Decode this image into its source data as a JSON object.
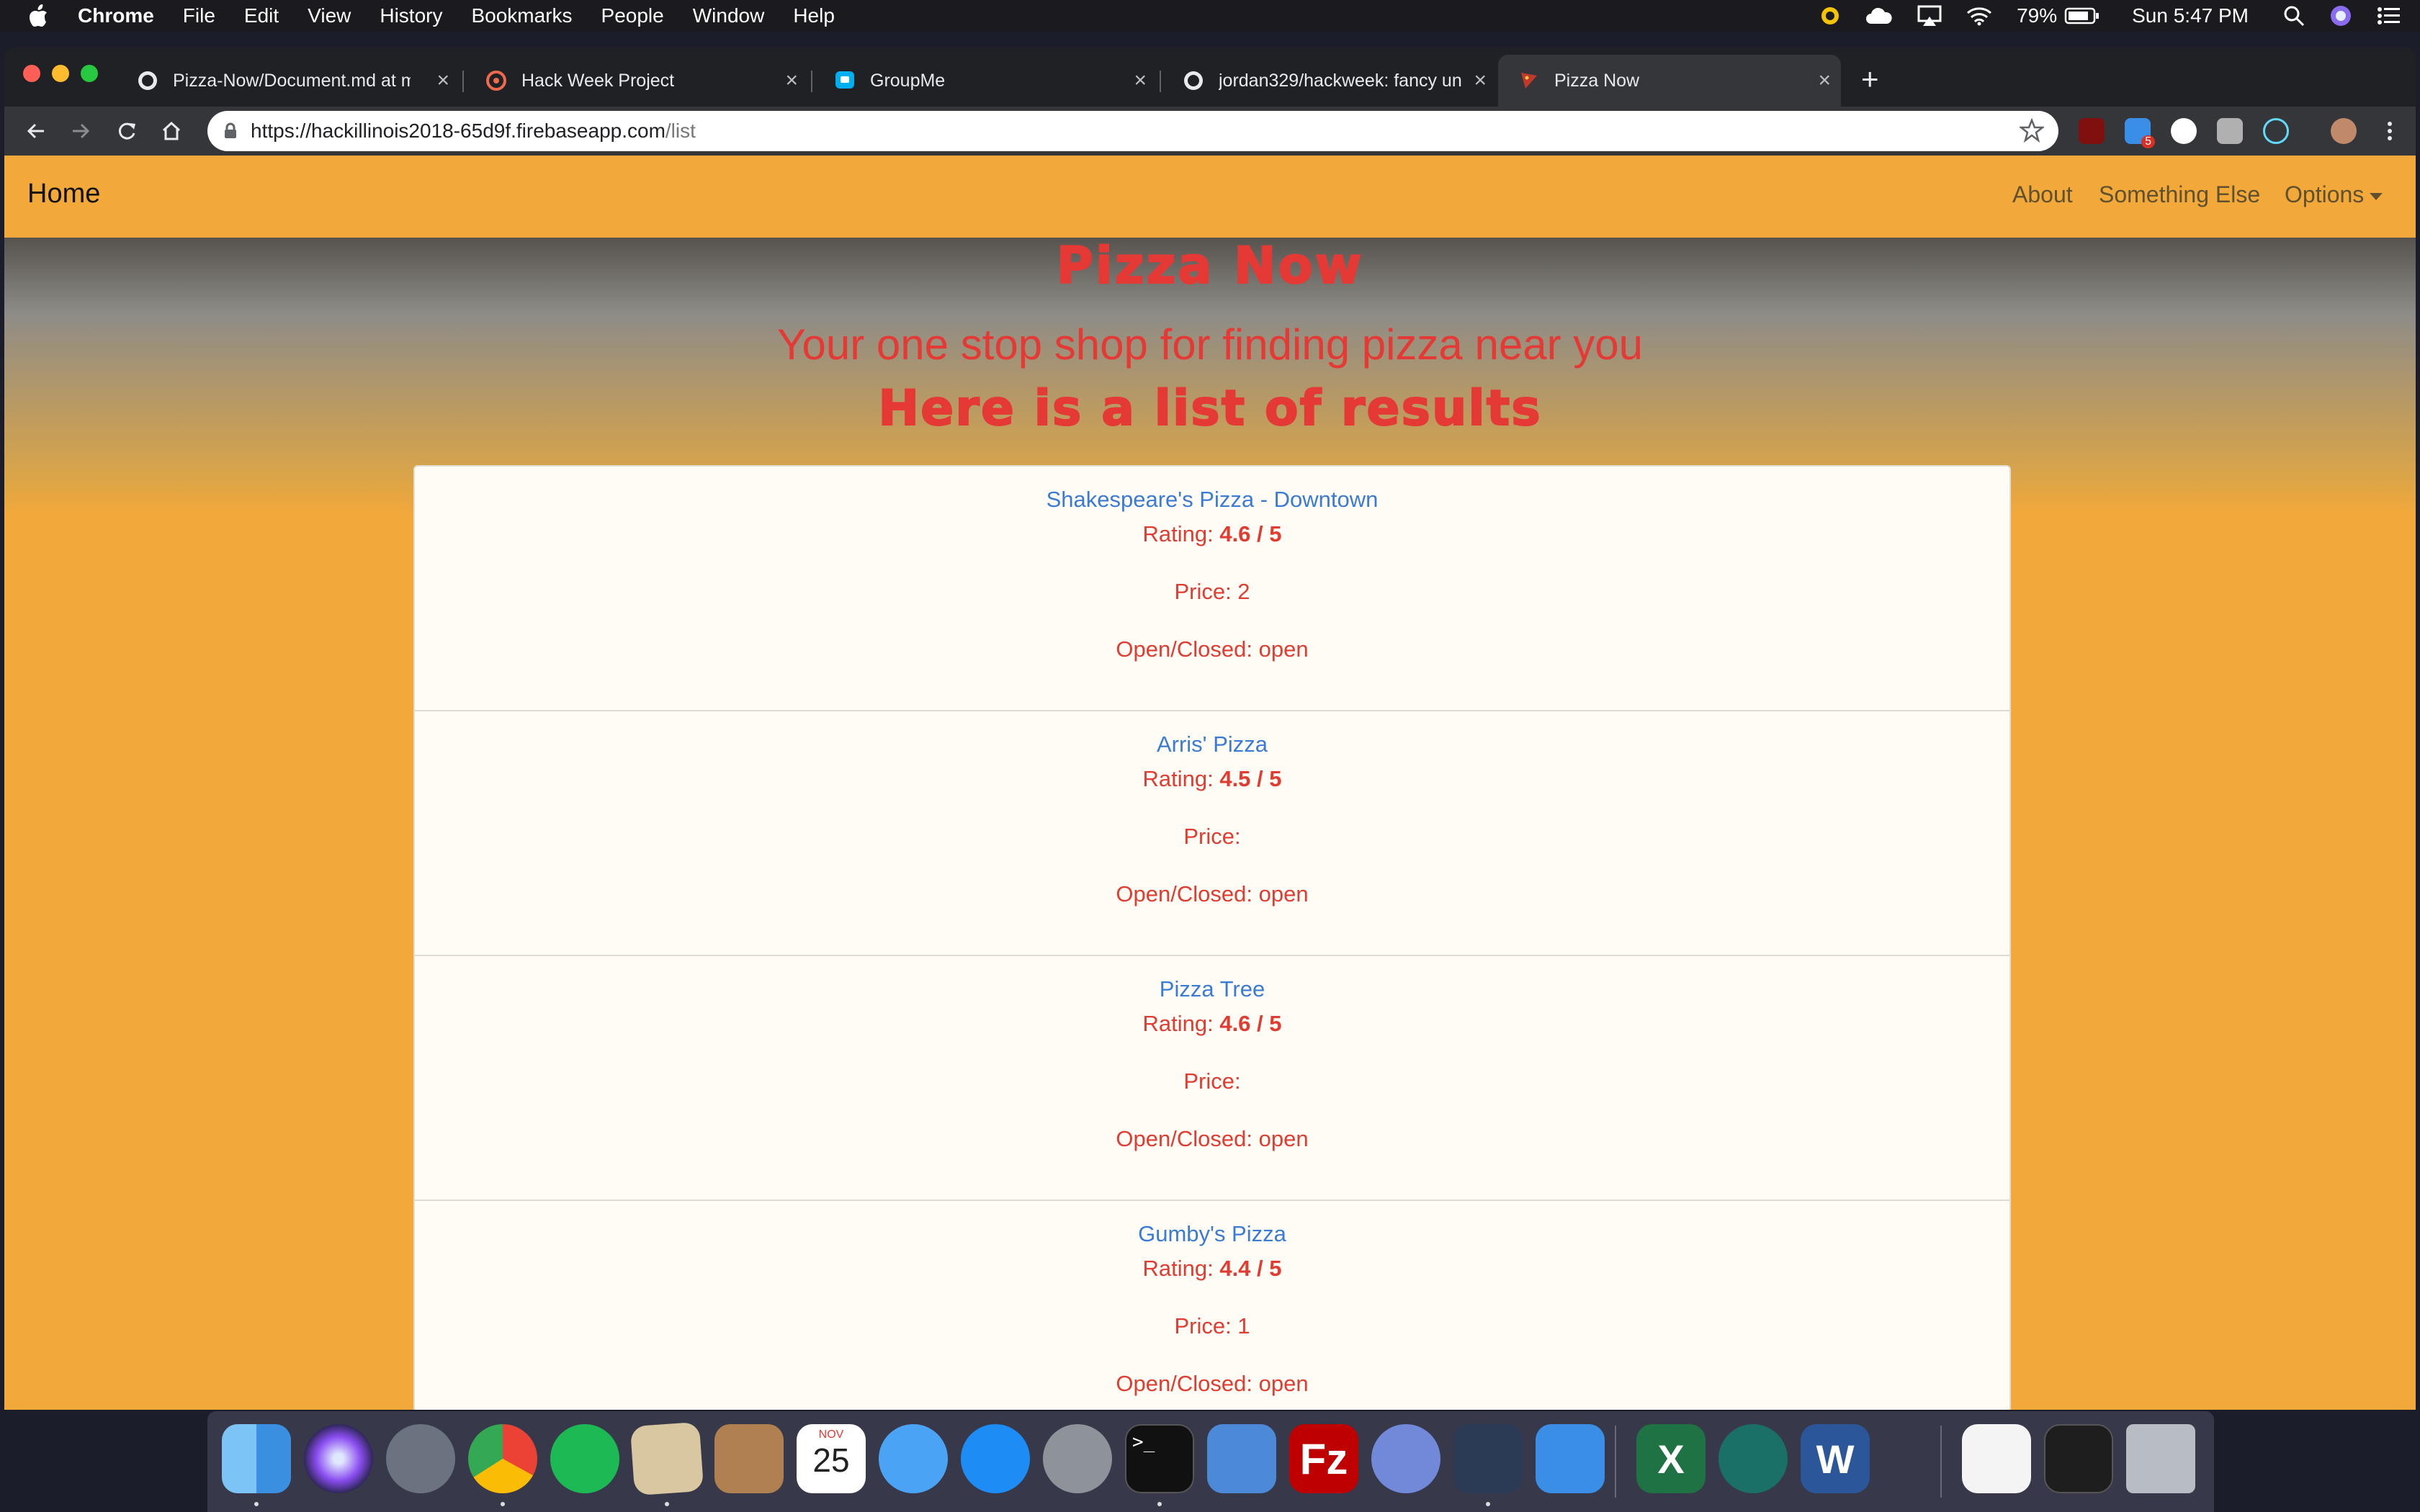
{
  "menubar": {
    "app": "Chrome",
    "items": [
      "File",
      "Edit",
      "View",
      "History",
      "Bookmarks",
      "People",
      "Window",
      "Help"
    ],
    "battery": "79%",
    "clock": "Sun 5:47 PM"
  },
  "tabs": [
    {
      "title": "Pizza-Now/Document.md at m",
      "icon": "github-icon"
    },
    {
      "title": "Hack Week Project",
      "icon": "hackweek-icon"
    },
    {
      "title": "GroupMe",
      "icon": "groupme-icon"
    },
    {
      "title": "jordan329/hackweek: fancy un",
      "icon": "github-icon"
    },
    {
      "title": "Pizza Now",
      "icon": "pizza-icon"
    }
  ],
  "address": {
    "url_main": "https://hackillinois2018-65d9f.firebaseapp.com",
    "url_path": "/list"
  },
  "extensions": {
    "badge": "5"
  },
  "navbar": {
    "brand": "Home",
    "about": "About",
    "something_else": "Something Else",
    "options": "Options"
  },
  "hero": {
    "title": "Pizza Now",
    "subtitle": "Your one stop shop for finding pizza near you",
    "results_heading": "Here is a list of results"
  },
  "results": [
    {
      "name": "Shakespeare's Pizza - Downtown",
      "rating_label": "Rating: ",
      "rating": "4.6 / 5",
      "price": "Price: 2",
      "status": "Open/Closed: open"
    },
    {
      "name": "Arris' Pizza",
      "rating_label": "Rating: ",
      "rating": "4.5 / 5",
      "price": "Price: ",
      "status": "Open/Closed: open"
    },
    {
      "name": "Pizza Tree",
      "rating_label": "Rating: ",
      "rating": "4.6 / 5",
      "price": "Price: ",
      "status": "Open/Closed: open"
    },
    {
      "name": "Gumby's Pizza",
      "rating_label": "Rating: ",
      "rating": "4.4 / 5",
      "price": "Price: 1",
      "status": "Open/Closed: open"
    }
  ],
  "dock": {
    "calendar_month": "NOV",
    "calendar_day": "25",
    "apps": [
      "finder-icon",
      "siri-icon",
      "launchpad-icon",
      "chrome-icon",
      "spotify-icon",
      "mail-icon",
      "contacts-icon",
      "calendar-icon",
      "messages-icon",
      "app-store-icon",
      "system-preferences-icon",
      "terminal-icon",
      "xcode-icon",
      "filezilla-icon",
      "discord-icon",
      "vscode-icon",
      "simulator-icon",
      "excel-icon",
      "gitkraken-icon",
      "word-icon",
      "preview-document-icon",
      "screenshot-icon",
      "trash-icon"
    ]
  },
  "colors": {
    "page_orange": "#f3a83a",
    "hero_red": "#e53935",
    "link_blue": "#3a7bd5"
  }
}
